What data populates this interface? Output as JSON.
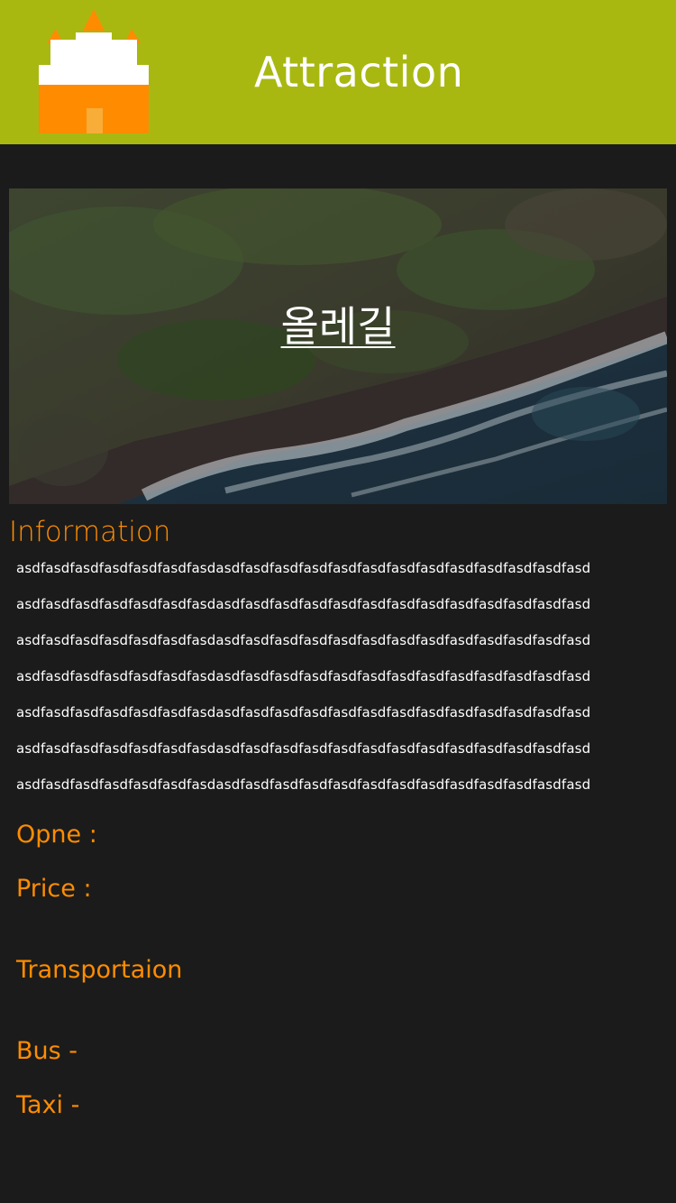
{
  "header": {
    "title": "Attraction",
    "logo_icon": "temple-icon",
    "background_color": "#a8b811"
  },
  "hero": {
    "title": "올레길",
    "image": "aerial-coastline-photo"
  },
  "information": {
    "label": "Information",
    "lines": [
      "asdfasdfasdfasdfasdfasdfasdasdfasdfasdfasdfasdfasdfasdfasdfasdfasdfasdfasdfasd",
      "asdfasdfasdfasdfasdfasdfasdasdfasdfasdfasdfasdfasdfasdfasdfasdfasdfasdfasdfasd",
      "asdfasdfasdfasdfasdfasdfasdasdfasdfasdfasdfasdfasdfasdfasdfasdfasdfasdfasdfasd",
      "asdfasdfasdfasdfasdfasdfasdasdfasdfasdfasdfasdfasdfasdfasdfasdfasdfasdfasdfasd",
      "asdfasdfasdfasdfasdfasdfasdasdfasdfasdfasdfasdfasdfasdfasdfasdfasdfasdfasdfasd",
      "asdfasdfasdfasdfasdfasdfasdasdfasdfasdfasdfasdfasdfasdfasdfasdfasdfasdfasdfasd",
      "asdfasdfasdfasdfasdfasdfasdasdfasdfasdfasdfasdfasdfasdfasdfasdfasdfasdfasdfasd"
    ]
  },
  "details": {
    "open_label": "Opne :",
    "price_label": "Price :",
    "transportation_label": "Transportaion",
    "bus_label": "Bus -",
    "taxi_label": "Taxi -"
  },
  "colors": {
    "accent": "#ff8c00",
    "background": "#1b1b1b",
    "text": "#ffffff"
  }
}
